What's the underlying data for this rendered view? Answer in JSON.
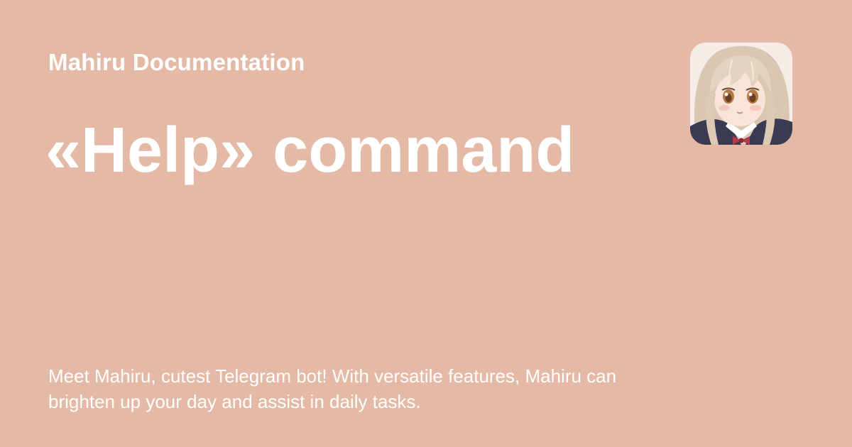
{
  "site": {
    "name": "Mahiru Documentation"
  },
  "page": {
    "title": "«Help» command",
    "description": "Meet Mahiru, cutest Telegram bot! With versatile features, Mahiru can brighten up your day and assist in daily tasks."
  },
  "avatar": {
    "icon": "anime-girl-avatar"
  },
  "colors": {
    "background": "#e4b9a6",
    "text": "#ffffff"
  }
}
